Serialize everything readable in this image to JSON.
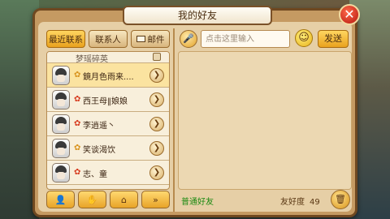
{
  "dialog": {
    "title": "我的好友",
    "close_icon": "close-icon"
  },
  "tabs": [
    {
      "label": "最近联系",
      "active": true
    },
    {
      "label": "联系人",
      "active": false
    },
    {
      "label": "邮件",
      "active": false,
      "icon": "mail-icon"
    }
  ],
  "friends": [
    {
      "name": "梦瑶碎英",
      "partial": true
    },
    {
      "name": "鏡月色雨来....",
      "selected": true,
      "icon": "flower-icon"
    },
    {
      "name": "西王母‖娘娘",
      "icon": "flower-icon"
    },
    {
      "name": "李逍遥丶",
      "icon": "flower-icon"
    },
    {
      "name": "笑谈渴饮",
      "icon": "flower-icon"
    },
    {
      "name": "志、童",
      "icon": "flower-icon"
    }
  ],
  "bottom_buttons": [
    {
      "icon": "add-friend-icon",
      "glyph": "👤"
    },
    {
      "icon": "hand-icon",
      "glyph": "✋"
    },
    {
      "icon": "home-icon",
      "glyph": "⌂"
    },
    {
      "icon": "next-page-icon",
      "glyph": "»"
    }
  ],
  "chat": {
    "input_placeholder": "点击这里输入",
    "send_label": "发送",
    "relation_label": "普通好友",
    "friendship_label": "友好度",
    "friendship_value": "49"
  },
  "colors": {
    "accent": "#e9a21e",
    "relation_text": "#1c8a12",
    "panel": "#e6cfa6"
  }
}
